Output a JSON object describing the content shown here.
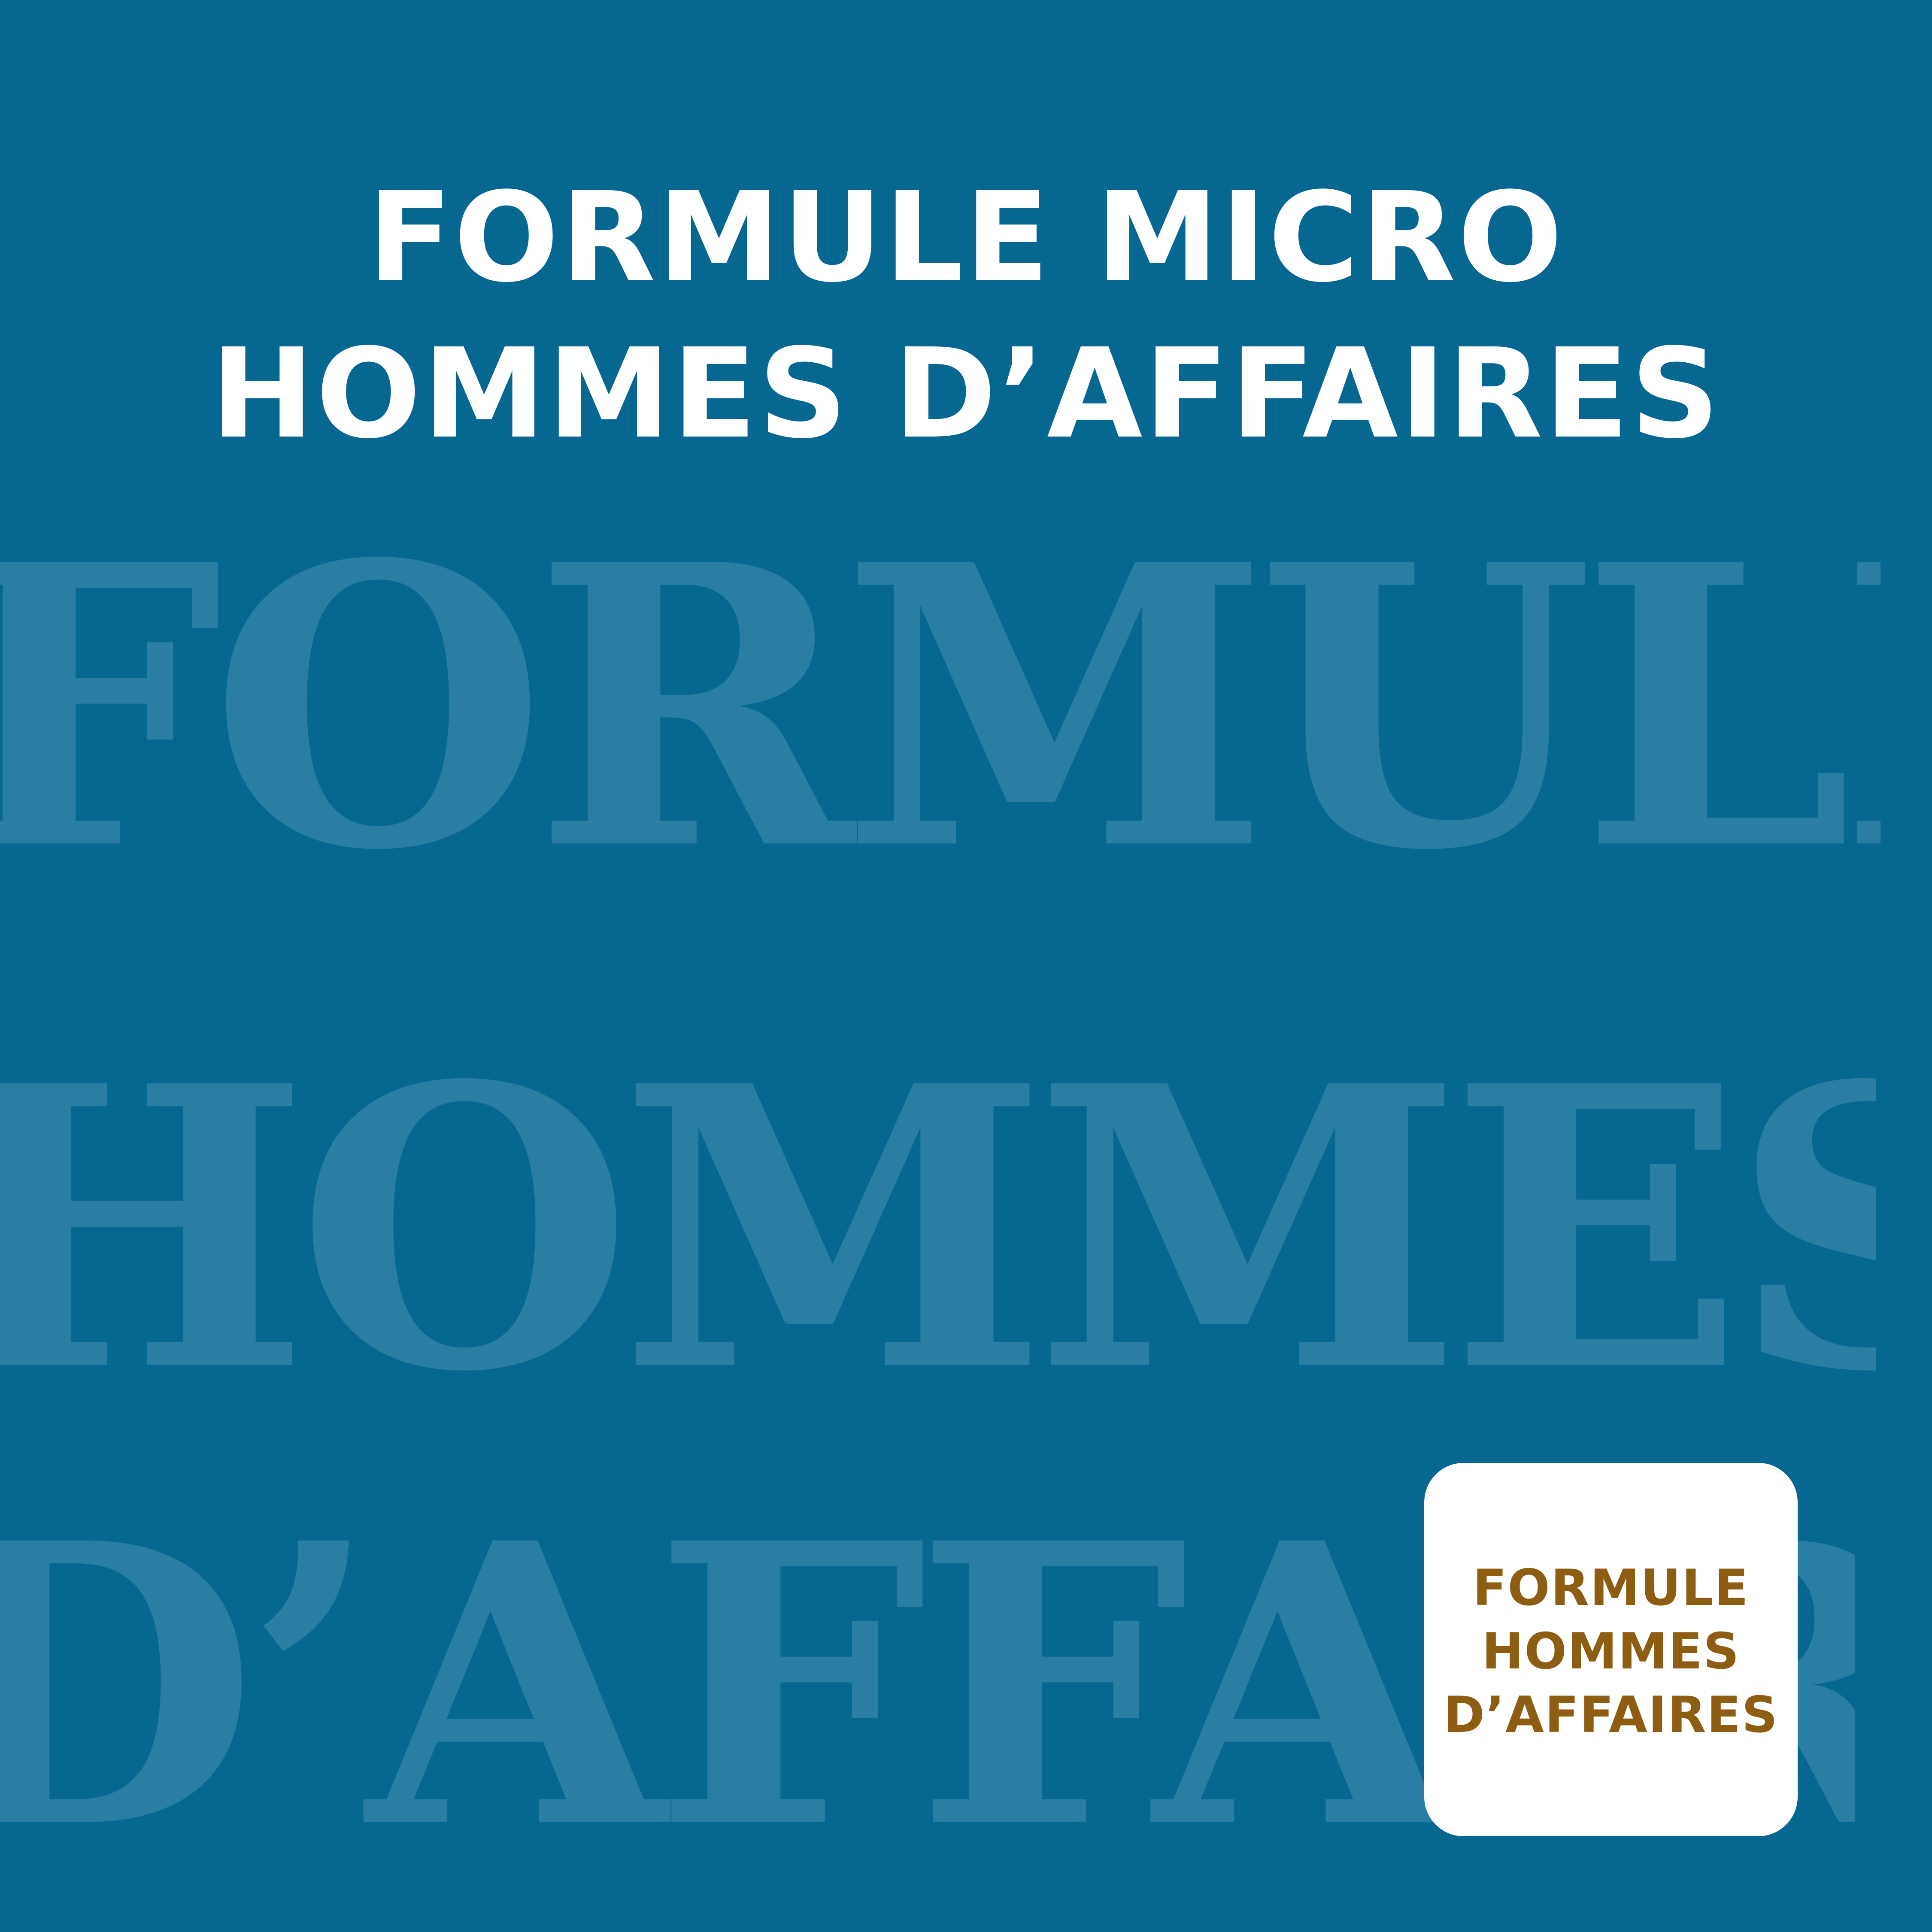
{
  "headline": {
    "line1": "FORMULE MICRO",
    "line2": "HOMMES D’AFFAIRES"
  },
  "background_words": {
    "word1": "FORMULE",
    "word2": "HOMMES",
    "word3": "D’AFFAIRES"
  },
  "badge": {
    "line1": "FORMULE",
    "line2": "HOMMES",
    "line3": "D’AFFAIRES"
  },
  "colors": {
    "background": "#066791",
    "watermark_text": "#2b7ea3",
    "headline_text": "#ffffff",
    "badge_background": "#ffffff",
    "badge_text": "#8d5e12"
  }
}
